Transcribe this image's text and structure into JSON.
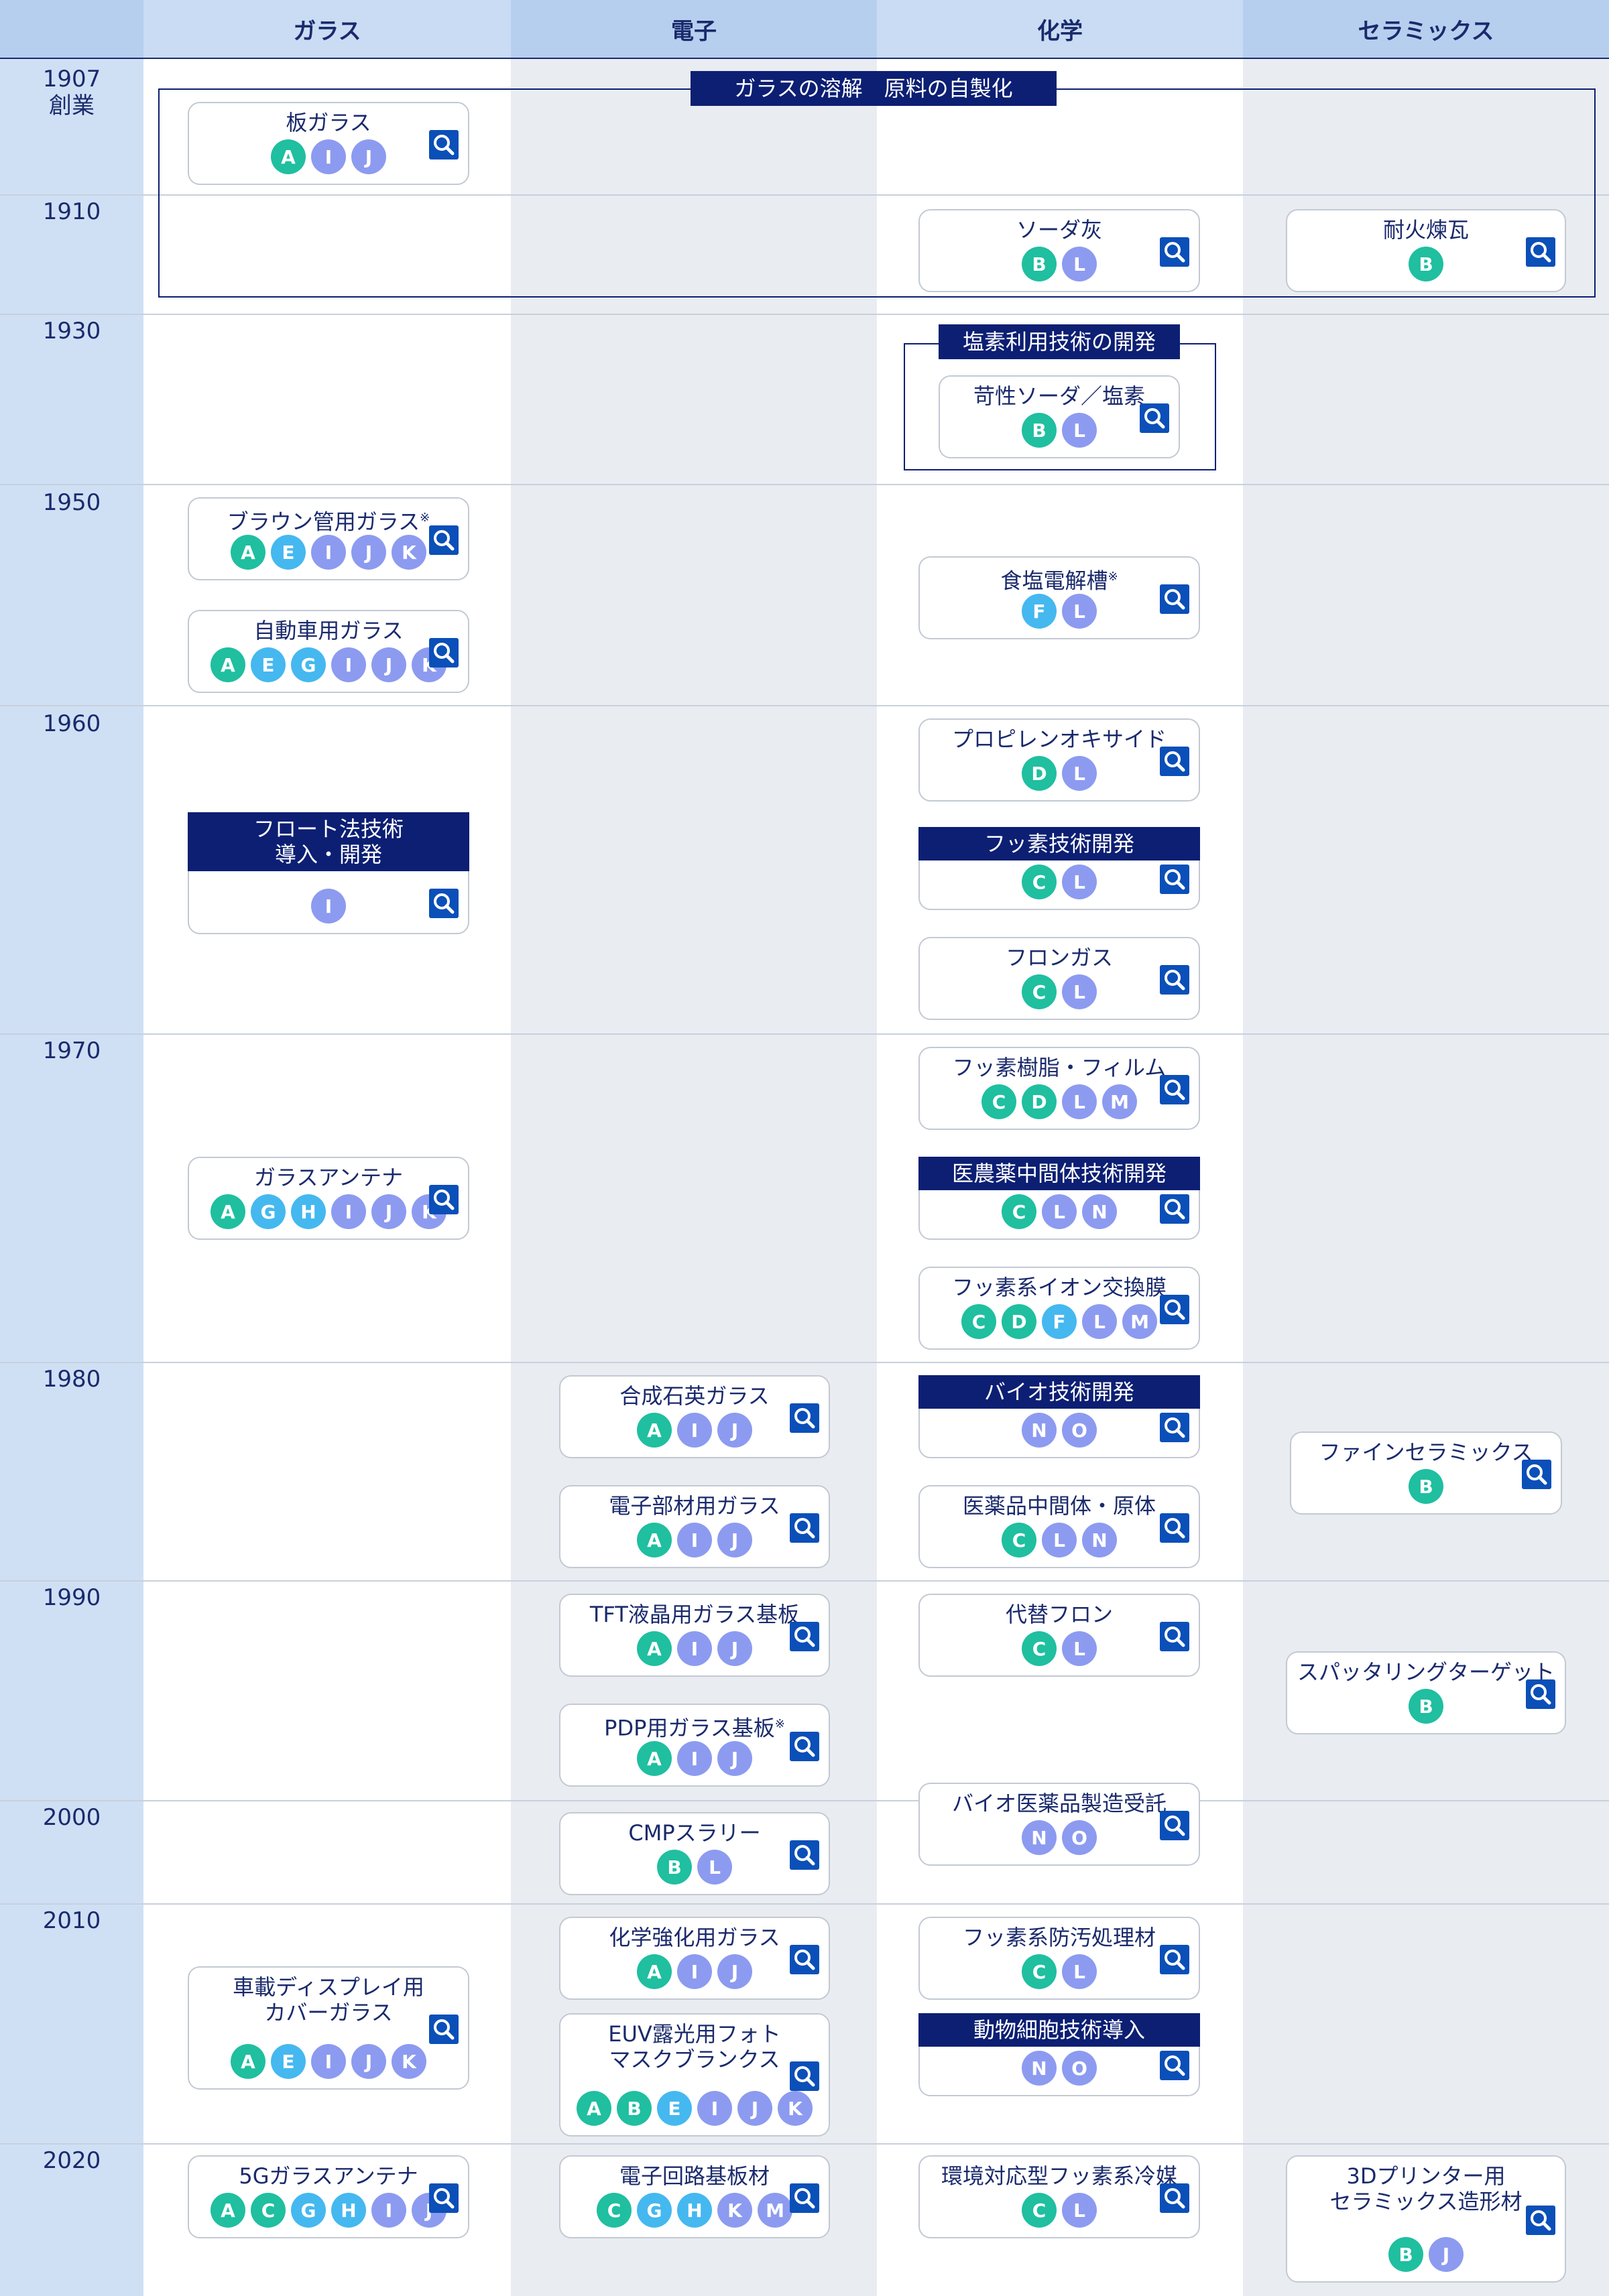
{
  "columns": [
    "ガラス",
    "電子",
    "化学",
    "セラミックス"
  ],
  "years": [
    {
      "label": "1907\n創業"
    },
    {
      "label": "1910"
    },
    {
      "label": "1930"
    },
    {
      "label": "1950"
    },
    {
      "label": "1960"
    },
    {
      "label": "1970"
    },
    {
      "label": "1980"
    },
    {
      "label": "1990"
    },
    {
      "label": "2000"
    },
    {
      "label": "2010"
    },
    {
      "label": "2020"
    }
  ],
  "group_labels": {
    "melting": "ガラスの溶解　原料の自製化",
    "chlorine": "塩素利用技術の開発"
  },
  "badge_colors": {
    "teal": "#1fbfa0",
    "periwinkle": "#8c9bf0",
    "sky": "#45b8f0"
  },
  "cards": [
    {
      "title": "板ガラス",
      "badges": [
        "A",
        "I",
        "J"
      ]
    },
    {
      "title": "ソーダ灰",
      "badges": [
        "B",
        "L"
      ]
    },
    {
      "title": "耐火煉瓦",
      "badges": [
        "B"
      ]
    },
    {
      "title": "苛性ソーダ／塩素",
      "badges": [
        "B",
        "L"
      ]
    },
    {
      "title": "ブラウン管用ガラス",
      "note": "※",
      "badges": [
        "A",
        "E",
        "I",
        "J",
        "K"
      ]
    },
    {
      "title": "自動車用ガラス",
      "badges": [
        "A",
        "E",
        "G",
        "I",
        "J",
        "K"
      ]
    },
    {
      "title": "食塩電解槽",
      "note": "※",
      "badges": [
        "F",
        "L"
      ]
    },
    {
      "title": "プロピレンオキサイド",
      "badges": [
        "D",
        "L"
      ]
    },
    {
      "band": "フロート法技術\n導入・開発",
      "badges": [
        "I"
      ]
    },
    {
      "band": "フッ素技術開発",
      "badges": [
        "C",
        "L"
      ]
    },
    {
      "title": "フロンガス",
      "badges": [
        "C",
        "L"
      ]
    },
    {
      "title": "フッ素樹脂・フィルム",
      "badges": [
        "C",
        "D",
        "L",
        "M"
      ]
    },
    {
      "title": "ガラスアンテナ",
      "badges": [
        "A",
        "G",
        "H",
        "I",
        "J",
        "K"
      ]
    },
    {
      "band": "医農薬中間体技術開発",
      "badges": [
        "C",
        "L",
        "N"
      ]
    },
    {
      "title": "フッ素系イオン交換膜",
      "badges": [
        "C",
        "D",
        "F",
        "L",
        "M"
      ]
    },
    {
      "title": "合成石英ガラス",
      "badges": [
        "A",
        "I",
        "J"
      ]
    },
    {
      "band": "バイオ技術開発",
      "badges": [
        "N",
        "O"
      ]
    },
    {
      "title": "ファインセラミックス",
      "badges": [
        "B"
      ]
    },
    {
      "title": "電子部材用ガラス",
      "badges": [
        "A",
        "I",
        "J"
      ]
    },
    {
      "title": "医薬品中間体・原体",
      "badges": [
        "C",
        "L",
        "N"
      ]
    },
    {
      "title": "TFT液晶用ガラス基板",
      "badges": [
        "A",
        "I",
        "J"
      ]
    },
    {
      "title": "代替フロン",
      "badges": [
        "C",
        "L"
      ]
    },
    {
      "title": "スパッタリングターゲット",
      "badges": [
        "B"
      ]
    },
    {
      "title": "PDP用ガラス基板",
      "note": "※",
      "badges": [
        "A",
        "I",
        "J"
      ]
    },
    {
      "title": "CMPスラリー",
      "badges": [
        "B",
        "L"
      ]
    },
    {
      "title": "バイオ医薬品製造受託",
      "badges": [
        "N",
        "O"
      ]
    },
    {
      "title": "化学強化用ガラス",
      "badges": [
        "A",
        "I",
        "J"
      ]
    },
    {
      "title": "フッ素系防汚処理材",
      "badges": [
        "C",
        "L"
      ]
    },
    {
      "title": "車載ディスプレイ用\nカバーガラス",
      "badges": [
        "A",
        "E",
        "I",
        "J",
        "K"
      ]
    },
    {
      "title": "EUV露光用フォト\nマスクブランクス",
      "badges": [
        "A",
        "B",
        "E",
        "I",
        "J",
        "K"
      ]
    },
    {
      "band": "動物細胞技術導入",
      "badges": [
        "N",
        "O"
      ]
    },
    {
      "title": "5Gガラスアンテナ",
      "badges": [
        "A",
        "C",
        "G",
        "H",
        "I",
        "J"
      ]
    },
    {
      "title": "電子回路基板材",
      "badges": [
        "C",
        "G",
        "H",
        "K",
        "M"
      ]
    },
    {
      "title": "環境対応型フッ素系冷媒",
      "badges": [
        "C",
        "L"
      ]
    },
    {
      "title": "3Dプリンター用\nセラミックス造形材",
      "badges": [
        "B",
        "J"
      ]
    }
  ]
}
